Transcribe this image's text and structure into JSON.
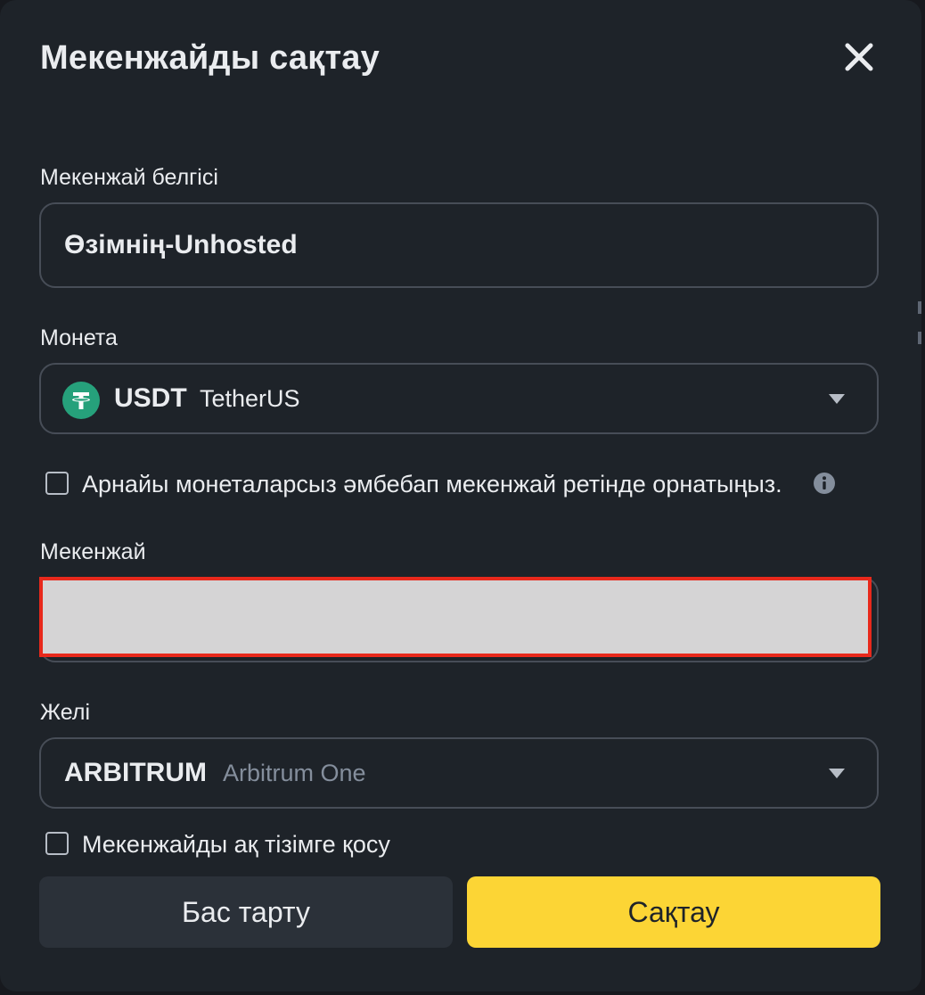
{
  "dialog": {
    "title": "Мекенжайды сақтау"
  },
  "address_label": {
    "label": "Мекенжай белгісі",
    "value": "Өзімнің-Unhosted"
  },
  "coin": {
    "label": "Монета",
    "symbol": "USDT",
    "name": "TetherUS",
    "icon": "tether-icon",
    "icon_color": "#26a17b"
  },
  "universal_checkbox": {
    "label": "Арнайы монеталарсыз әмбебап мекенжай ретінде орнатыңыз.",
    "checked": false
  },
  "address": {
    "label": "Мекенжай",
    "value": ""
  },
  "network": {
    "label": "Желі",
    "symbol": "ARBITRUM",
    "name": "Arbitrum One"
  },
  "whitelist_checkbox": {
    "label": "Мекенжайды ақ тізімге қосу",
    "checked": false
  },
  "buttons": {
    "cancel": "Бас тарту",
    "save": "Сақтау"
  },
  "colors": {
    "background": "#1e2329",
    "accent": "#fcd535",
    "redaction_border": "#e8291c"
  }
}
